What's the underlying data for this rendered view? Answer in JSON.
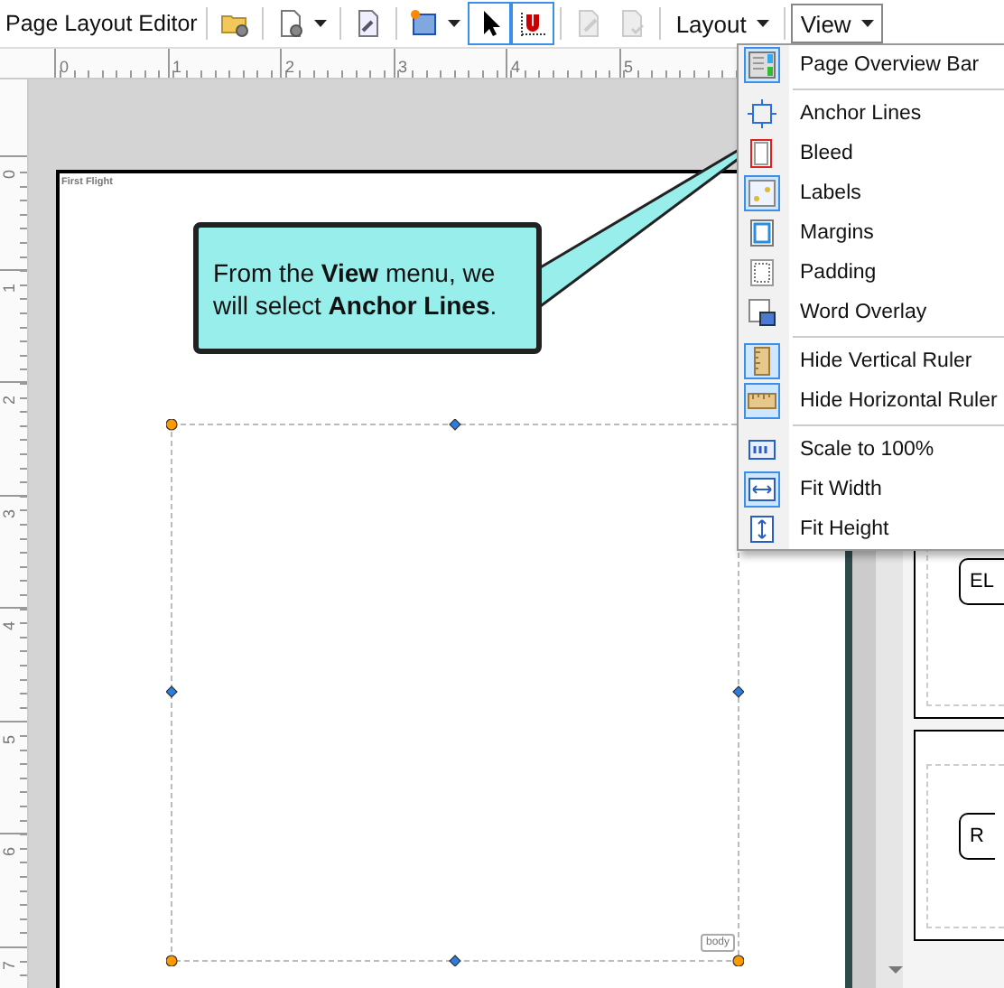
{
  "toolbar": {
    "title": "Page Layout Editor",
    "groups": [
      [
        {
          "kind": "folder",
          "dropdown": false,
          "selected": false,
          "disabled": false
        }
      ],
      [
        {
          "kind": "document",
          "dropdown": true,
          "selected": false,
          "disabled": false
        }
      ],
      [
        {
          "kind": "wrench",
          "dropdown": false,
          "selected": false,
          "disabled": false
        }
      ],
      [
        {
          "kind": "shape",
          "dropdown": true,
          "selected": false,
          "disabled": false
        },
        {
          "kind": "pointer",
          "dropdown": false,
          "selected": true,
          "disabled": false
        },
        {
          "kind": "magnet",
          "dropdown": false,
          "selected": true,
          "disabled": false
        }
      ],
      [
        {
          "kind": "edit",
          "dropdown": false,
          "selected": false,
          "disabled": true
        },
        {
          "kind": "check",
          "dropdown": false,
          "selected": false,
          "disabled": true
        }
      ]
    ],
    "menus": [
      {
        "label": "Layout",
        "selected": false
      },
      {
        "label": "View",
        "selected": true
      }
    ]
  },
  "rulers": {
    "horizontal": [
      "0",
      "1",
      "2",
      "3",
      "4",
      "5"
    ],
    "vertical": [
      "0",
      "1",
      "2",
      "3",
      "4",
      "5",
      "6",
      "7"
    ]
  },
  "page": {
    "label": "First Flight",
    "tag": "body"
  },
  "callout": {
    "text": "From the **View** menu, we will select **Anchor Lines**."
  },
  "view_menu": {
    "sections": [
      [
        {
          "label": "Page Overview Bar",
          "kind": "overview",
          "checked": true
        }
      ],
      [
        {
          "label": "Anchor Lines",
          "kind": "anchor",
          "checked": false
        },
        {
          "label": "Bleed",
          "kind": "bleed",
          "checked": false
        },
        {
          "label": "Labels",
          "kind": "labels",
          "checked": true
        },
        {
          "label": "Margins",
          "kind": "margins",
          "checked": false
        },
        {
          "label": "Padding",
          "kind": "padding",
          "checked": false
        },
        {
          "label": "Word Overlay",
          "kind": "word",
          "checked": false
        }
      ],
      [
        {
          "label": "Hide Vertical Ruler",
          "kind": "vruler",
          "checked": true
        },
        {
          "label": "Hide Horizontal Ruler",
          "kind": "hruler",
          "checked": true
        }
      ],
      [
        {
          "label": "Scale to 100%",
          "kind": "scale",
          "checked": false
        },
        {
          "label": "Fit Width",
          "kind": "fitwidth",
          "checked": true
        },
        {
          "label": "Fit Height",
          "kind": "fitheight",
          "checked": false
        }
      ]
    ]
  },
  "thumbnails": [
    {
      "label": "EL"
    },
    {
      "label": "R"
    }
  ]
}
